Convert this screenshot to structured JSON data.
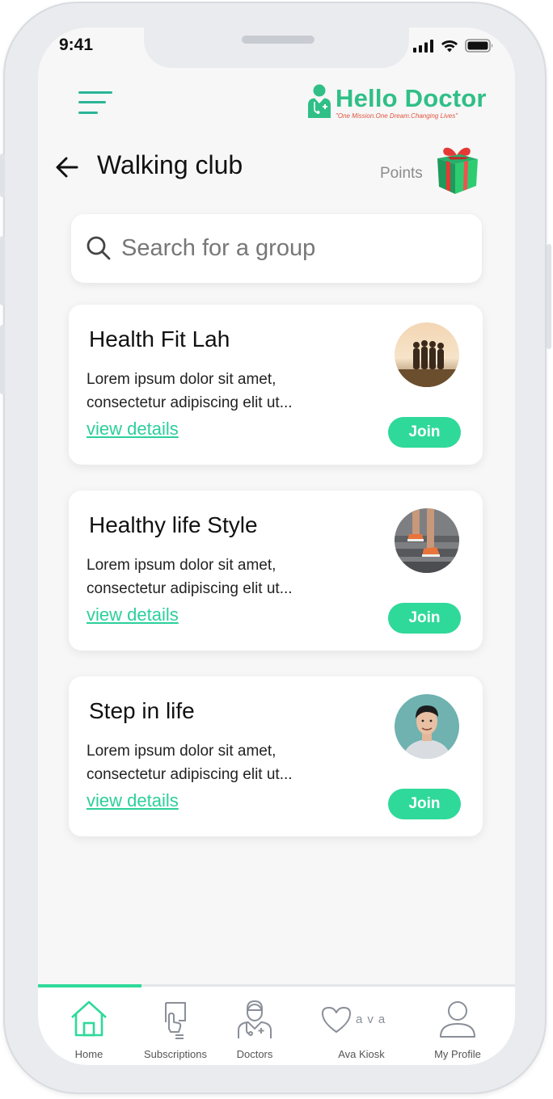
{
  "status_bar": {
    "time": "9:41"
  },
  "header": {
    "logo_title": "Hello Doctor",
    "logo_tagline": "\"One Mission.One Dream.Changing Lives\""
  },
  "page": {
    "title": "Walking club",
    "points_label": "Points"
  },
  "search": {
    "placeholder": "Search for a group",
    "value": ""
  },
  "groups": [
    {
      "name": "Health Fit Lah",
      "description_line1": "Lorem ipsum dolor sit amet,",
      "description_line2": "consectetur adipiscing elit ut...",
      "link_label": "view details",
      "button_label": "Join"
    },
    {
      "name": "Healthy life Style",
      "description_line1": "Lorem ipsum dolor sit amet,",
      "description_line2": "consectetur adipiscing elit ut...",
      "link_label": "view details",
      "button_label": "Join"
    },
    {
      "name": "Step in life",
      "description_line1": "Lorem ipsum dolor sit amet,",
      "description_line2": "consectetur adipiscing elit ut...",
      "link_label": "view details",
      "button_label": "Join"
    }
  ],
  "tabbar": {
    "active": "Home",
    "tabs": [
      {
        "label": "Home",
        "icon": "home-icon"
      },
      {
        "label": "Subscriptions",
        "icon": "subscriptions-icon"
      },
      {
        "label": "Doctors",
        "icon": "doctor-icon"
      },
      {
        "label": "Ava Kiosk",
        "icon": "heart-ava-icon",
        "icon_text": "ava"
      },
      {
        "label": "My Profile",
        "icon": "profile-icon"
      }
    ]
  },
  "colors": {
    "accent": "#2fd99a",
    "link": "#2ccf9a",
    "menu_icon": "#2bb597",
    "background": "#f7f7f7",
    "logo_tagline": "#e0533f"
  }
}
